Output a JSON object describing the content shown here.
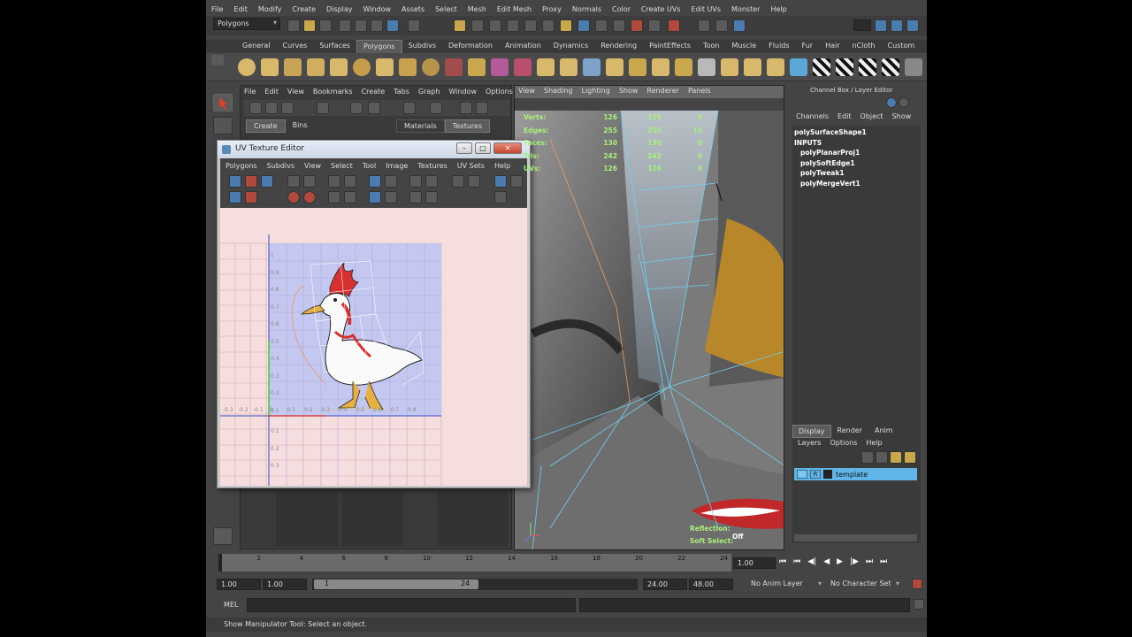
{
  "main_menu": [
    "File",
    "Edit",
    "Modify",
    "Create",
    "Display",
    "Window",
    "Assets",
    "Select",
    "Mesh",
    "Edit Mesh",
    "Proxy",
    "Normals",
    "Color",
    "Create UVs",
    "Edit UVs",
    "Monster",
    "Help"
  ],
  "status_line": {
    "menu_set": "Polygons"
  },
  "shelf_tabs": [
    "General",
    "Curves",
    "Surfaces",
    "Polygons",
    "Subdivs",
    "Deformation",
    "Animation",
    "Dynamics",
    "Rendering",
    "PaintEffects",
    "Toon",
    "Muscle",
    "Fluids",
    "Fur",
    "Hair",
    "nCloth",
    "Custom"
  ],
  "shelf_active": "Polygons",
  "outliner": {
    "menu": [
      "File",
      "Edit",
      "View",
      "Bookmarks",
      "Create",
      "Tabs",
      "Graph",
      "Window",
      "Options"
    ],
    "tabs": [
      "Create",
      "Bins"
    ],
    "right_tabs": [
      "Materials",
      "Textures"
    ]
  },
  "uv_editor": {
    "title": "UV Texture Editor",
    "menu": [
      "Polygons",
      "Subdivs",
      "View",
      "Select",
      "Tool",
      "Image",
      "Textures",
      "UV Sets",
      "Help"
    ],
    "v_ticks": [
      "1",
      "0.9",
      "0.8",
      "0.7",
      "0.6",
      "0.5",
      "0.4",
      "0.3",
      "0.2",
      "0.1"
    ],
    "h_ticks": [
      "-0.3",
      "-0.2",
      "-0.1",
      "0",
      "0.1",
      "0.2",
      "0.3",
      "0.4",
      "0.5",
      "0.6",
      "0.7",
      "0.8"
    ],
    "neg_ticks": [
      "0.1",
      "0.2",
      "0.3"
    ]
  },
  "viewport": {
    "menu": [
      "View",
      "Shading",
      "Lighting",
      "Show",
      "Renderer",
      "Panels"
    ],
    "hud": {
      "rows": [
        {
          "label": "Verts:",
          "a": "126",
          "b": "126",
          "c": "0"
        },
        {
          "label": "Edges:",
          "a": "255",
          "b": "255",
          "c": "13"
        },
        {
          "label": "Faces:",
          "a": "130",
          "b": "130",
          "c": "0"
        },
        {
          "label": "Tris:",
          "a": "242",
          "b": "242",
          "c": "0"
        },
        {
          "label": "UVs:",
          "a": "126",
          "b": "126",
          "c": "0"
        }
      ]
    },
    "reflection_label": "Reflection:",
    "reflection_value": "Off",
    "soft_select_label": "Soft Select:"
  },
  "channel_box": {
    "title": "Channel Box / Layer Editor",
    "menu": [
      "Channels",
      "Edit",
      "Object",
      "Show"
    ],
    "shape": "polySurfaceShape1",
    "inputs_label": "INPUTS",
    "inputs": [
      "polyPlanarProj1",
      "polySoftEdge1",
      "polyTweak1",
      "polyMergeVert1"
    ],
    "layer_tabs": [
      "Display",
      "Render",
      "Anim"
    ],
    "layer_menu": [
      "Layers",
      "Options",
      "Help"
    ],
    "layer": {
      "visibility": "",
      "type": "R",
      "name": "template"
    }
  },
  "timeline": {
    "ticks": [
      "2",
      "4",
      "6",
      "8",
      "10",
      "12",
      "14",
      "16",
      "18",
      "20",
      "22",
      "24"
    ],
    "current": "1.00"
  },
  "range": {
    "start": "1.00",
    "playback_start": "1.00",
    "slider_start": "1",
    "slider_end": "24",
    "playback_end": "24.00",
    "end": "48.00",
    "anim_layer": "No Anim Layer",
    "char_set": "No Character Set"
  },
  "command": {
    "label": "MEL"
  },
  "help_line": "Show Manipulator Tool: Select an object.",
  "colors": {
    "accent": "#5b9bd5",
    "layer_row": "#5fb4e8",
    "hud_green": "#a8f07a"
  }
}
